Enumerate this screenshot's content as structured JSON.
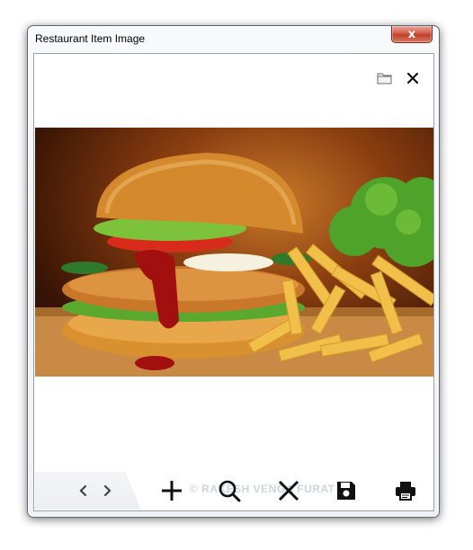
{
  "window": {
    "title": "Restaurant Item Image",
    "close_glyph": "x"
  },
  "viewer": {
    "image_alt": "Burger with fries and lettuce",
    "top_icons": [
      "folder-icon",
      "close-icon"
    ]
  },
  "toolbar": {
    "buttons": [
      "prev-icon",
      "next-icon",
      "add-icon",
      "zoom-icon",
      "delete-icon",
      "save-icon",
      "print-icon"
    ],
    "watermark": "© RAKESH VENGA FURAT"
  }
}
